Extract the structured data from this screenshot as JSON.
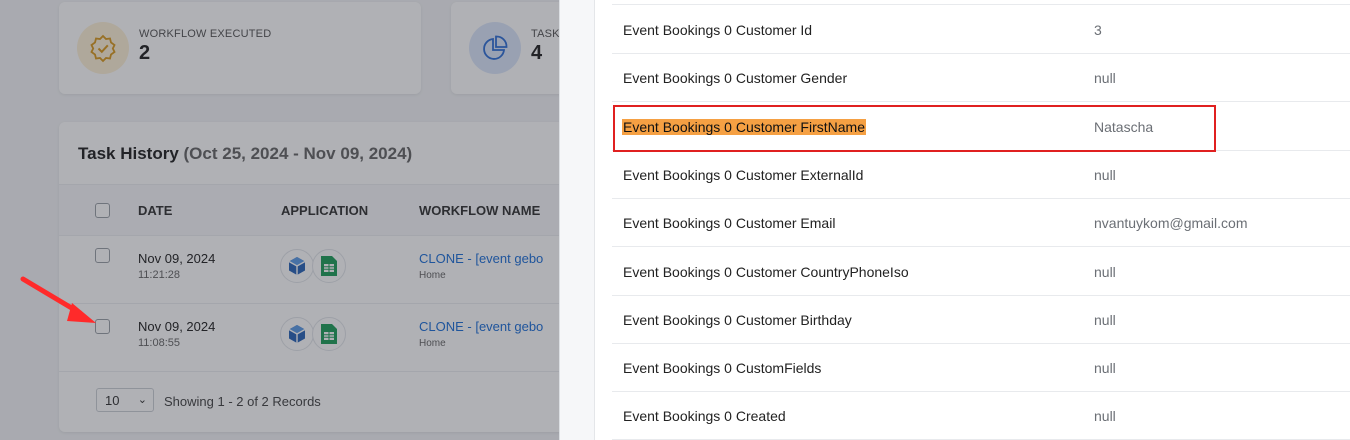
{
  "stats": [
    {
      "label": "WORKFLOW EXECUTED",
      "value": "2",
      "icon": "badge-check-icon"
    },
    {
      "label": "TASK",
      "value": "4",
      "icon": "pie-chart-icon"
    }
  ],
  "history": {
    "title": "Task History",
    "range": "(Oct 25, 2024 - Nov 09, 2024)",
    "columns": {
      "date": "DATE",
      "application": "APPLICATION",
      "workflow": "WORKFLOW NAME"
    },
    "rows": [
      {
        "date": "Nov 09, 2024",
        "time": "11:21:28",
        "workflow": "CLONE - [event gebo",
        "folder": "Home"
      },
      {
        "date": "Nov 09, 2024",
        "time": "11:08:55",
        "workflow": "CLONE - [event gebo",
        "folder": "Home"
      }
    ],
    "page_size": "10",
    "records": "Showing 1 - 2 of 2 Records"
  },
  "fields": [
    {
      "key": "Event Bookings 0 Customer Id",
      "value": "3"
    },
    {
      "key": "Event Bookings 0 Customer Gender",
      "value": "null"
    },
    {
      "key": "Event Bookings 0 Customer FirstName",
      "value": "Natascha",
      "highlight": true
    },
    {
      "key": "Event Bookings 0 Customer ExternalId",
      "value": "null"
    },
    {
      "key": "Event Bookings 0 Customer Email",
      "value": "nvantuykom@gmail.com"
    },
    {
      "key": "Event Bookings 0 Customer CountryPhoneIso",
      "value": "null"
    },
    {
      "key": "Event Bookings 0 Customer Birthday",
      "value": "null"
    },
    {
      "key": "Event Bookings 0 CustomFields",
      "value": "null"
    },
    {
      "key": "Event Bookings 0 Created",
      "value": "null"
    }
  ],
  "colors": {
    "highlight": "#f5a043",
    "annotation": "#e02020",
    "link": "#1d6fd8"
  }
}
